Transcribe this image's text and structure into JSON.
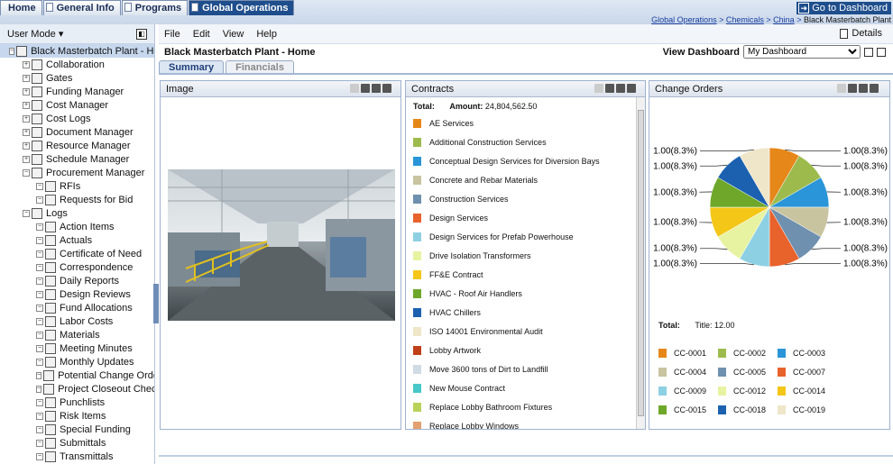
{
  "top_tabs": [
    "Home",
    "General Info",
    "Programs",
    "Global Operations"
  ],
  "goto_dashboard": "Go to Dashboard",
  "breadcrumb": {
    "links": [
      "Global Operations",
      "Chemicals",
      "China"
    ],
    "current": "Black Masterbatch Plant"
  },
  "left": {
    "mode": "User Mode",
    "tree": [
      {
        "label": "Black Masterbatch Plant - Hom",
        "level": 0,
        "pm": "−",
        "root": true
      },
      {
        "label": "Collaboration",
        "level": 1,
        "pm": "+"
      },
      {
        "label": "Gates",
        "level": 1,
        "pm": "+"
      },
      {
        "label": "Funding Manager",
        "level": 1,
        "pm": "+"
      },
      {
        "label": "Cost Manager",
        "level": 1,
        "pm": "+"
      },
      {
        "label": "Cost Logs",
        "level": 1,
        "pm": "+"
      },
      {
        "label": "Document Manager",
        "level": 1,
        "pm": "+"
      },
      {
        "label": "Resource Manager",
        "level": 1,
        "pm": "+"
      },
      {
        "label": "Schedule Manager",
        "level": 1,
        "pm": "+"
      },
      {
        "label": "Procurement Manager",
        "level": 1,
        "pm": "−"
      },
      {
        "label": "RFIs",
        "level": 2,
        "pm": "−"
      },
      {
        "label": "Requests for Bid",
        "level": 2,
        "pm": "−"
      },
      {
        "label": "Logs",
        "level": 1,
        "pm": "−"
      },
      {
        "label": "Action Items",
        "level": 2,
        "pm": "−"
      },
      {
        "label": "Actuals",
        "level": 2,
        "pm": "−"
      },
      {
        "label": "Certificate of Need",
        "level": 2,
        "pm": "−"
      },
      {
        "label": "Correspondence",
        "level": 2,
        "pm": "−"
      },
      {
        "label": "Daily Reports",
        "level": 2,
        "pm": "−"
      },
      {
        "label": "Design Reviews",
        "level": 2,
        "pm": "−"
      },
      {
        "label": "Fund Allocations",
        "level": 2,
        "pm": "−"
      },
      {
        "label": "Labor Costs",
        "level": 2,
        "pm": "−"
      },
      {
        "label": "Materials",
        "level": 2,
        "pm": "−"
      },
      {
        "label": "Meeting Minutes",
        "level": 2,
        "pm": "−"
      },
      {
        "label": "Monthly Updates",
        "level": 2,
        "pm": "−"
      },
      {
        "label": "Potential Change Orders",
        "level": 2,
        "pm": "−"
      },
      {
        "label": "Project Closeout Checklist",
        "level": 2,
        "pm": "−"
      },
      {
        "label": "Punchlists",
        "level": 2,
        "pm": "−"
      },
      {
        "label": "Risk Items",
        "level": 2,
        "pm": "−"
      },
      {
        "label": "Special Funding",
        "level": 2,
        "pm": "−"
      },
      {
        "label": "Submittals",
        "level": 2,
        "pm": "−"
      },
      {
        "label": "Transmittals",
        "level": 2,
        "pm": "−"
      }
    ]
  },
  "menu": [
    "File",
    "Edit",
    "View",
    "Help"
  ],
  "details": "Details",
  "page_title": "Black Masterbatch Plant - Home",
  "view_dashboard": {
    "label": "View Dashboard",
    "selected": "My Dashboard"
  },
  "sub_tabs": [
    "Summary",
    "Financials"
  ],
  "panels": {
    "image": "Image",
    "contracts": "Contracts",
    "change_orders": "Change Orders"
  },
  "contracts": {
    "total_label": "Total:",
    "amount_label": "Amount:",
    "amount": "24,804,562.50",
    "items": [
      {
        "name": "AE Services",
        "color": "#e6871a"
      },
      {
        "name": "Additional Construction Services",
        "color": "#9dbb4d"
      },
      {
        "name": "Conceptual Design Services for Diversion Bays",
        "color": "#2a95d8"
      },
      {
        "name": "Concrete and Rebar Materials",
        "color": "#c9c4a0"
      },
      {
        "name": "Construction Services",
        "color": "#6f90ae"
      },
      {
        "name": "Design Services",
        "color": "#e8622c"
      },
      {
        "name": "Design Services for Prefab Powerhouse",
        "color": "#8ed0e3"
      },
      {
        "name": "Drive Isolation Transformers",
        "color": "#e8f3a2"
      },
      {
        "name": "FF&E Contract",
        "color": "#f3c618"
      },
      {
        "name": "HVAC - Roof Air Handlers",
        "color": "#6ea72a"
      },
      {
        "name": "HVAC Chillers",
        "color": "#1b61b0"
      },
      {
        "name": "ISO 14001 Environmental Audit",
        "color": "#efe6c9"
      },
      {
        "name": "Lobby Artwork",
        "color": "#c0401a"
      },
      {
        "name": "Move 3600 tons of Dirt to Landfill",
        "color": "#cfdbe5"
      },
      {
        "name": "New Mouse Contract",
        "color": "#48c8c8"
      },
      {
        "name": "Replace Lobby Bathroom Fixtures",
        "color": "#b9d25a"
      },
      {
        "name": "Replace Lobby Windows",
        "color": "#e3a070"
      }
    ]
  },
  "change_orders": {
    "total_label": "Total:",
    "title_label": "Title:",
    "title_value": "12.00",
    "slice_label": "1.00(8.3%)",
    "legend": [
      {
        "id": "CC-0001",
        "color": "#e6871a"
      },
      {
        "id": "CC-0002",
        "color": "#9dbb4d"
      },
      {
        "id": "CC-0003",
        "color": "#2a95d8"
      },
      {
        "id": "CC-0004",
        "color": "#c9c4a0"
      },
      {
        "id": "CC-0005",
        "color": "#6f90ae"
      },
      {
        "id": "CC-0007",
        "color": "#e8622c"
      },
      {
        "id": "CC-0009",
        "color": "#8ed0e3"
      },
      {
        "id": "CC-0012",
        "color": "#e8f3a2"
      },
      {
        "id": "CC-0014",
        "color": "#f3c618"
      },
      {
        "id": "CC-0015",
        "color": "#6ea72a"
      },
      {
        "id": "CC-0018",
        "color": "#1b61b0"
      },
      {
        "id": "CC-0019",
        "color": "#efe6c9"
      }
    ]
  },
  "chart_data": {
    "type": "pie",
    "categories": [
      "CC-0001",
      "CC-0002",
      "CC-0003",
      "CC-0004",
      "CC-0005",
      "CC-0007",
      "CC-0009",
      "CC-0012",
      "CC-0014",
      "CC-0015",
      "CC-0018",
      "CC-0019"
    ],
    "values": [
      1,
      1,
      1,
      1,
      1,
      1,
      1,
      1,
      1,
      1,
      1,
      1
    ],
    "labels": [
      "1.00(8.3%)",
      "1.00(8.3%)",
      "1.00(8.3%)",
      "1.00(8.3%)",
      "1.00(8.3%)",
      "1.00(8.3%)",
      "1.00(8.3%)",
      "1.00(8.3%)",
      "1.00(8.3%)",
      "1.00(8.3%)",
      "1.00(8.3%)",
      "1.00(8.3%)"
    ],
    "title": "Change Orders"
  }
}
